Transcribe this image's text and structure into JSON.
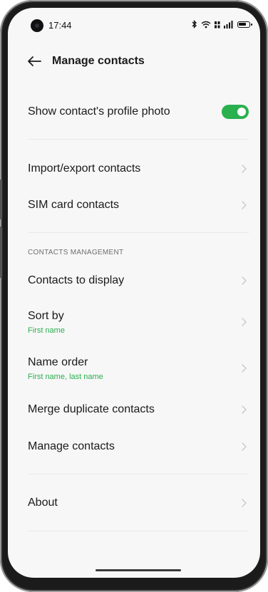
{
  "status_bar": {
    "time": "17:44",
    "icons": [
      "bluetooth-icon",
      "wifi-icon",
      "hd-icon",
      "signal-icon",
      "battery-icon"
    ]
  },
  "header": {
    "title": "Manage contacts",
    "back_icon": "arrow-left-icon"
  },
  "settings": {
    "profile_photo": {
      "label": "Show contact's profile photo",
      "enabled": true
    },
    "import_export": {
      "label": "Import/export contacts"
    },
    "sim_contacts": {
      "label": "SIM card contacts"
    },
    "section_header": "CONTACTS MANAGEMENT",
    "contacts_to_display": {
      "label": "Contacts to display"
    },
    "sort_by": {
      "label": "Sort by",
      "value": "First name"
    },
    "name_order": {
      "label": "Name order",
      "value": "First name, last name"
    },
    "merge_duplicates": {
      "label": "Merge duplicate contacts"
    },
    "manage_contacts": {
      "label": "Manage contacts"
    },
    "about": {
      "label": "About"
    }
  },
  "colors": {
    "accent": "#2ab04f",
    "background": "#f7f7f7",
    "text": "#1a1a1a"
  }
}
